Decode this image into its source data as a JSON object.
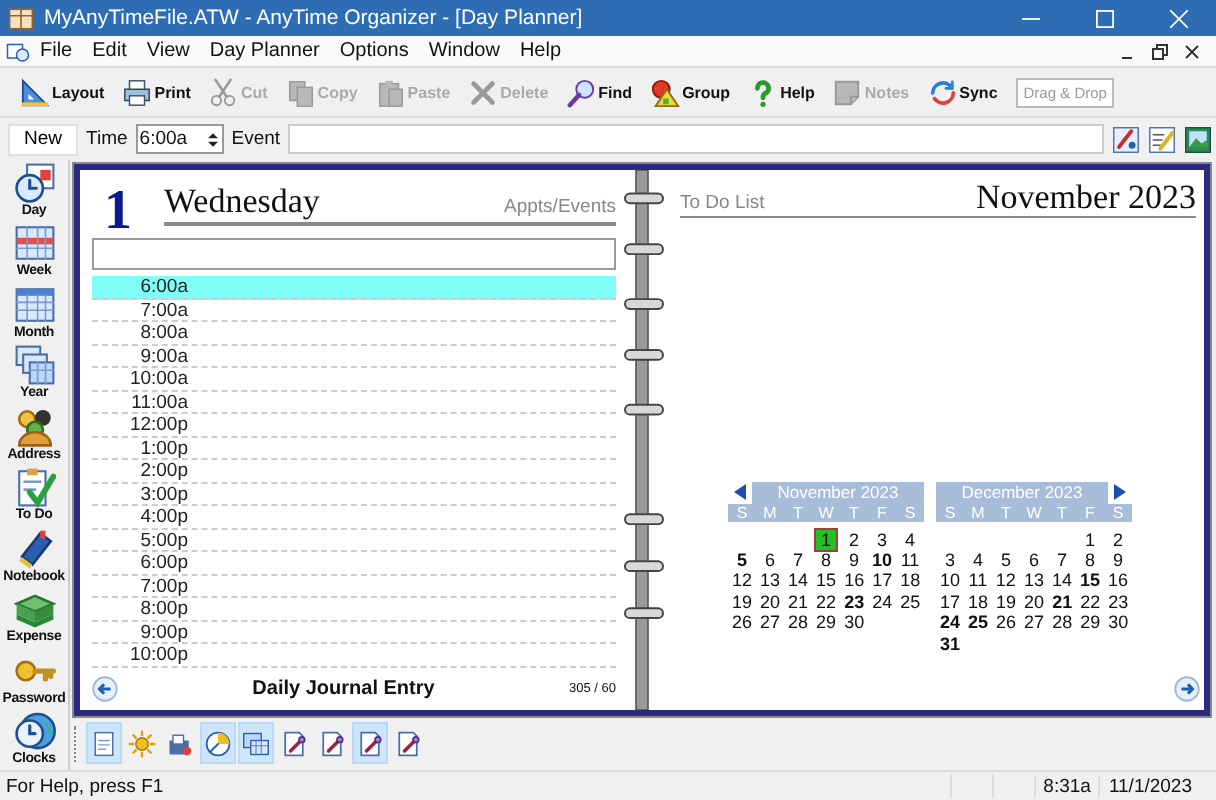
{
  "window": {
    "title": "MyAnyTimeFile.ATW - AnyTime Organizer - [Day Planner]"
  },
  "menu": [
    "File",
    "Edit",
    "View",
    "Day Planner",
    "Options",
    "Window",
    "Help"
  ],
  "toolbar": {
    "buttons": [
      {
        "label": "Layout",
        "kind": "layout",
        "disabled": false
      },
      {
        "label": "Print",
        "kind": "print",
        "disabled": false
      },
      {
        "label": "Cut",
        "kind": "cut",
        "disabled": true
      },
      {
        "label": "Copy",
        "kind": "copy",
        "disabled": true
      },
      {
        "label": "Paste",
        "kind": "paste",
        "disabled": true
      },
      {
        "label": "Delete",
        "kind": "delete",
        "disabled": true
      },
      {
        "label": "Find",
        "kind": "find",
        "disabled": false
      },
      {
        "label": "Group",
        "kind": "group",
        "disabled": false
      },
      {
        "label": "Help",
        "kind": "help",
        "disabled": false
      },
      {
        "label": "Notes",
        "kind": "notes",
        "disabled": true
      },
      {
        "label": "Sync",
        "kind": "sync",
        "disabled": false
      }
    ],
    "drop_target": "Drag & Drop"
  },
  "event_bar": {
    "new_button": "New",
    "time_label": "Time",
    "time_value": "6:00a",
    "event_label": "Event"
  },
  "sidebar": [
    {
      "label": "Day",
      "kind": "day"
    },
    {
      "label": "Week",
      "kind": "week"
    },
    {
      "label": "Month",
      "kind": "month"
    },
    {
      "label": "Year",
      "kind": "year"
    },
    {
      "label": "Address",
      "kind": "address"
    },
    {
      "label": "To Do",
      "kind": "todo"
    },
    {
      "label": "Notebook",
      "kind": "notebook"
    },
    {
      "label": "Expense",
      "kind": "expense"
    },
    {
      "label": "Password",
      "kind": "password"
    },
    {
      "label": "Clocks",
      "kind": "clocks"
    }
  ],
  "planner": {
    "day_number": "1",
    "weekday": "Wednesday",
    "appts_label": "Appts/Events",
    "slots": [
      {
        "time": "6:00a",
        "selected": true
      },
      {
        "time": "7:00a",
        "selected": false
      },
      {
        "time": "8:00a",
        "selected": false
      },
      {
        "time": "9:00a",
        "selected": false
      },
      {
        "time": "10:00a",
        "selected": false
      },
      {
        "time": "11:00a",
        "selected": false
      },
      {
        "time": "12:00p",
        "selected": false
      },
      {
        "time": "1:00p",
        "selected": false
      },
      {
        "time": "2:00p",
        "selected": false
      },
      {
        "time": "3:00p",
        "selected": false
      },
      {
        "time": "4:00p",
        "selected": false
      },
      {
        "time": "5:00p",
        "selected": false
      },
      {
        "time": "6:00p",
        "selected": false
      },
      {
        "time": "7:00p",
        "selected": false
      },
      {
        "time": "8:00p",
        "selected": false
      },
      {
        "time": "9:00p",
        "selected": false
      },
      {
        "time": "10:00p",
        "selected": false
      }
    ],
    "footer": "Daily Journal Entry",
    "day_count": "305 / 60",
    "todo_label": "To Do List",
    "month_title": "November 2023",
    "calendars": [
      {
        "title": "November 2023",
        "weekdays": [
          "S",
          "M",
          "T",
          "W",
          "T",
          "F",
          "S"
        ],
        "weeks": [
          {
            "right_aligned": true,
            "days": [
              {
                "d": "1",
                "bold": false,
                "selected": true
              },
              {
                "d": "2",
                "bold": false,
                "selected": false
              },
              {
                "d": "3",
                "bold": false,
                "selected": false
              },
              {
                "d": "4",
                "bold": false,
                "selected": false
              }
            ]
          },
          {
            "days": [
              {
                "d": "5",
                "bold": true,
                "selected": false
              },
              {
                "d": "6",
                "bold": false,
                "selected": false
              },
              {
                "d": "7",
                "bold": false,
                "selected": false
              },
              {
                "d": "8",
                "bold": false,
                "selected": false
              },
              {
                "d": "9",
                "bold": false,
                "selected": false
              },
              {
                "d": "10",
                "bold": true,
                "selected": false
              },
              {
                "d": "11",
                "bold": false,
                "selected": false
              }
            ]
          },
          {
            "days": [
              {
                "d": "12",
                "bold": false,
                "selected": false
              },
              {
                "d": "13",
                "bold": false,
                "selected": false
              },
              {
                "d": "14",
                "bold": false,
                "selected": false
              },
              {
                "d": "15",
                "bold": false,
                "selected": false
              },
              {
                "d": "16",
                "bold": false,
                "selected": false
              },
              {
                "d": "17",
                "bold": false,
                "selected": false
              },
              {
                "d": "18",
                "bold": false,
                "selected": false
              }
            ]
          },
          {
            "days": [
              {
                "d": "19",
                "bold": false,
                "selected": false
              },
              {
                "d": "20",
                "bold": false,
                "selected": false
              },
              {
                "d": "21",
                "bold": false,
                "selected": false
              },
              {
                "d": "22",
                "bold": false,
                "selected": false
              },
              {
                "d": "23",
                "bold": true,
                "selected": false
              },
              {
                "d": "24",
                "bold": false,
                "selected": false
              },
              {
                "d": "25",
                "bold": false,
                "selected": false
              }
            ]
          },
          {
            "right_aligned": false,
            "days": [
              {
                "d": "26",
                "bold": false,
                "selected": false
              },
              {
                "d": "27",
                "bold": false,
                "selected": false
              },
              {
                "d": "28",
                "bold": false,
                "selected": false
              },
              {
                "d": "29",
                "bold": false,
                "selected": false
              },
              {
                "d": "30",
                "bold": false,
                "selected": false
              }
            ]
          }
        ]
      },
      {
        "title": "December 2023",
        "weekdays": [
          "S",
          "M",
          "T",
          "W",
          "T",
          "F",
          "S"
        ],
        "weeks": [
          {
            "right_aligned": true,
            "days": [
              {
                "d": "1",
                "bold": false,
                "selected": false
              },
              {
                "d": "2",
                "bold": false,
                "selected": false
              }
            ]
          },
          {
            "days": [
              {
                "d": "3",
                "bold": false,
                "selected": false
              },
              {
                "d": "4",
                "bold": false,
                "selected": false
              },
              {
                "d": "5",
                "bold": false,
                "selected": false
              },
              {
                "d": "6",
                "bold": false,
                "selected": false
              },
              {
                "d": "7",
                "bold": false,
                "selected": false
              },
              {
                "d": "8",
                "bold": false,
                "selected": false
              },
              {
                "d": "9",
                "bold": false,
                "selected": false
              }
            ]
          },
          {
            "days": [
              {
                "d": "10",
                "bold": false,
                "selected": false
              },
              {
                "d": "11",
                "bold": false,
                "selected": false
              },
              {
                "d": "12",
                "bold": false,
                "selected": false
              },
              {
                "d": "13",
                "bold": false,
                "selected": false
              },
              {
                "d": "14",
                "bold": false,
                "selected": false
              },
              {
                "d": "15",
                "bold": true,
                "selected": false
              },
              {
                "d": "16",
                "bold": false,
                "selected": false
              }
            ]
          },
          {
            "days": [
              {
                "d": "17",
                "bold": false,
                "selected": false
              },
              {
                "d": "18",
                "bold": false,
                "selected": false
              },
              {
                "d": "19",
                "bold": false,
                "selected": false
              },
              {
                "d": "20",
                "bold": false,
                "selected": false
              },
              {
                "d": "21",
                "bold": true,
                "selected": false
              },
              {
                "d": "22",
                "bold": false,
                "selected": false
              },
              {
                "d": "23",
                "bold": false,
                "selected": false
              }
            ]
          },
          {
            "days": [
              {
                "d": "24",
                "bold": true,
                "selected": false
              },
              {
                "d": "25",
                "bold": true,
                "selected": false
              },
              {
                "d": "26",
                "bold": false,
                "selected": false
              },
              {
                "d": "27",
                "bold": false,
                "selected": false
              },
              {
                "d": "28",
                "bold": false,
                "selected": false
              },
              {
                "d": "29",
                "bold": false,
                "selected": false
              },
              {
                "d": "30",
                "bold": false,
                "selected": false
              }
            ]
          },
          {
            "right_aligned": false,
            "days": [
              {
                "d": "31",
                "bold": true,
                "selected": false
              }
            ]
          }
        ]
      }
    ]
  },
  "bottom_toolbar": [
    {
      "kind": "page",
      "pressed": true
    },
    {
      "kind": "sun",
      "pressed": false
    },
    {
      "kind": "inbox",
      "pressed": false
    },
    {
      "kind": "pie",
      "pressed": true
    },
    {
      "kind": "windows",
      "pressed": true
    },
    {
      "kind": "docpen",
      "pressed": false
    },
    {
      "kind": "docpen",
      "pressed": false
    },
    {
      "kind": "docpen",
      "pressed": true
    },
    {
      "kind": "docpen",
      "pressed": false
    }
  ],
  "status_bar": {
    "message": "For Help, press F1",
    "time": "8:31a",
    "date": "11/1/2023"
  }
}
